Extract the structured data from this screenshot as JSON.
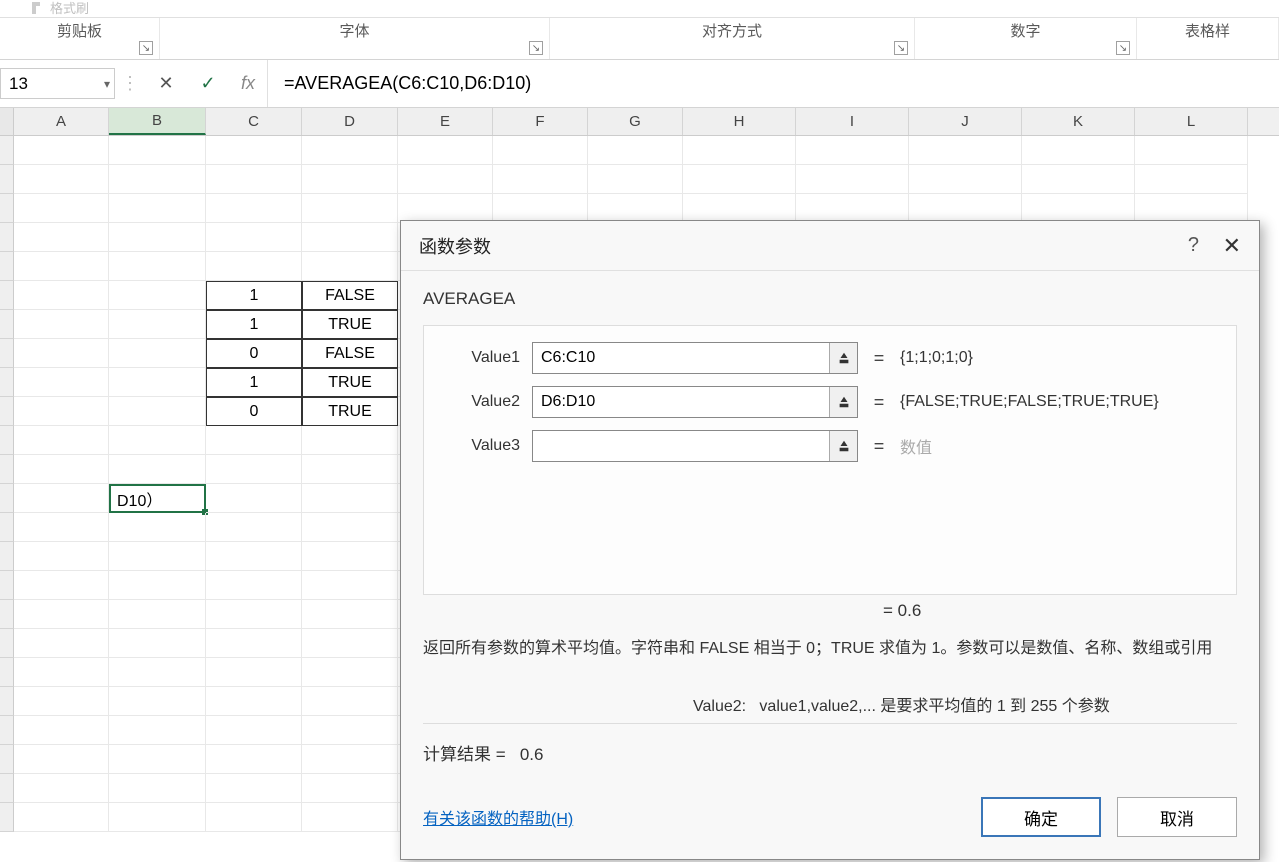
{
  "ribbon": {
    "format_brush": "格式刷",
    "groups": {
      "clipboard": "剪贴板",
      "font": "字体",
      "alignment": "对齐方式",
      "number": "数字",
      "styles": "表格样"
    }
  },
  "formula_bar": {
    "name_box": "13",
    "formula": "=AVERAGEA(C6:C10,D6:D10)"
  },
  "columns": [
    "A",
    "B",
    "C",
    "D",
    "E",
    "F",
    "G",
    "H",
    "I",
    "J",
    "K",
    "L"
  ],
  "sheet_data": {
    "c_values": [
      "1",
      "1",
      "0",
      "1",
      "0"
    ],
    "d_values": [
      "FALSE",
      "TRUE",
      "FALSE",
      "TRUE",
      "TRUE"
    ],
    "b13": "D10）"
  },
  "dialog": {
    "title": "函数参数",
    "function_name": "AVERAGEA",
    "params": [
      {
        "label": "Value1",
        "value": "C6:C10",
        "result": "{1;1;0;1;0}"
      },
      {
        "label": "Value2",
        "value": "D6:D10",
        "result": "{FALSE;TRUE;FALSE;TRUE;TRUE}"
      },
      {
        "label": "Value3",
        "value": "",
        "result": "数值"
      }
    ],
    "intermediate_result": "=   0.6",
    "description": "返回所有参数的算术平均值。字符串和 FALSE 相当于 0；TRUE 求值为 1。参数可以是数值、名称、数组或引用",
    "param_hint_label": "Value2:",
    "param_hint_text": "value1,value2,... 是要求平均值的 1 到 255 个参数",
    "calc_label": "计算结果 =",
    "calc_value": "0.6",
    "help_link": "有关该函数的帮助(H)",
    "ok": "确定",
    "cancel": "取消"
  }
}
